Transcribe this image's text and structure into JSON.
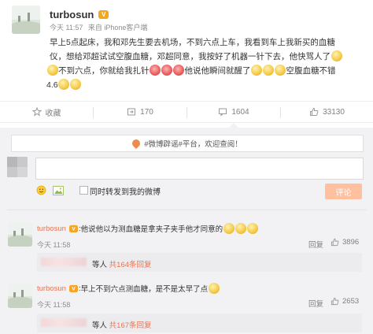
{
  "post": {
    "username": "turbosun",
    "verified_badge": "vip-badge",
    "time": "今天 11:57",
    "source": "来自 iPhone客户端",
    "text_parts": {
      "l1": "早上5点起床，我和邓先生要去机场，不到六点上车，我看到车上我新买的血糖",
      "l2": "仪，想给邓超试试空腹血糖，邓超同意，我按好了机器一针下去，他快骂人了",
      "l3a": "不到六点，你就给我扎针",
      "l3b": "他说他瞬间就醒了",
      "l3c": "空腹血糖不错",
      "l4": "4.6"
    }
  },
  "actions": {
    "collect": "收藏",
    "forward_count": "170",
    "comment_count": "1604",
    "like_count": "33130"
  },
  "comment_panel": {
    "notice": "#微博辟谣#平台，欢迎查阅！",
    "input_placeholder": "",
    "forward_checkbox_label": "同时转发到我的微博",
    "submit_label": "评论"
  },
  "comments": [
    {
      "username": "turbosun",
      "text": "他说他以为测血糖是拿夹子夹手他才同意的",
      "time": "今天 11:58",
      "reply_label": "回复",
      "like_count": "3896",
      "sub_prefix": "等人",
      "sub_link": "共164条回复"
    },
    {
      "username": "turbosun",
      "text": "早上不到六点测血糖，是不是太早了点",
      "time": "今天 11:58",
      "reply_label": "回复",
      "like_count": "2653",
      "sub_prefix": "等人",
      "sub_link": "共167条回复"
    }
  ],
  "colors": {
    "accent": "#eb7350",
    "submit_button": "#ffc09f",
    "panel_bg": "#f2f2f5",
    "vip_badge": "#f5a623"
  }
}
